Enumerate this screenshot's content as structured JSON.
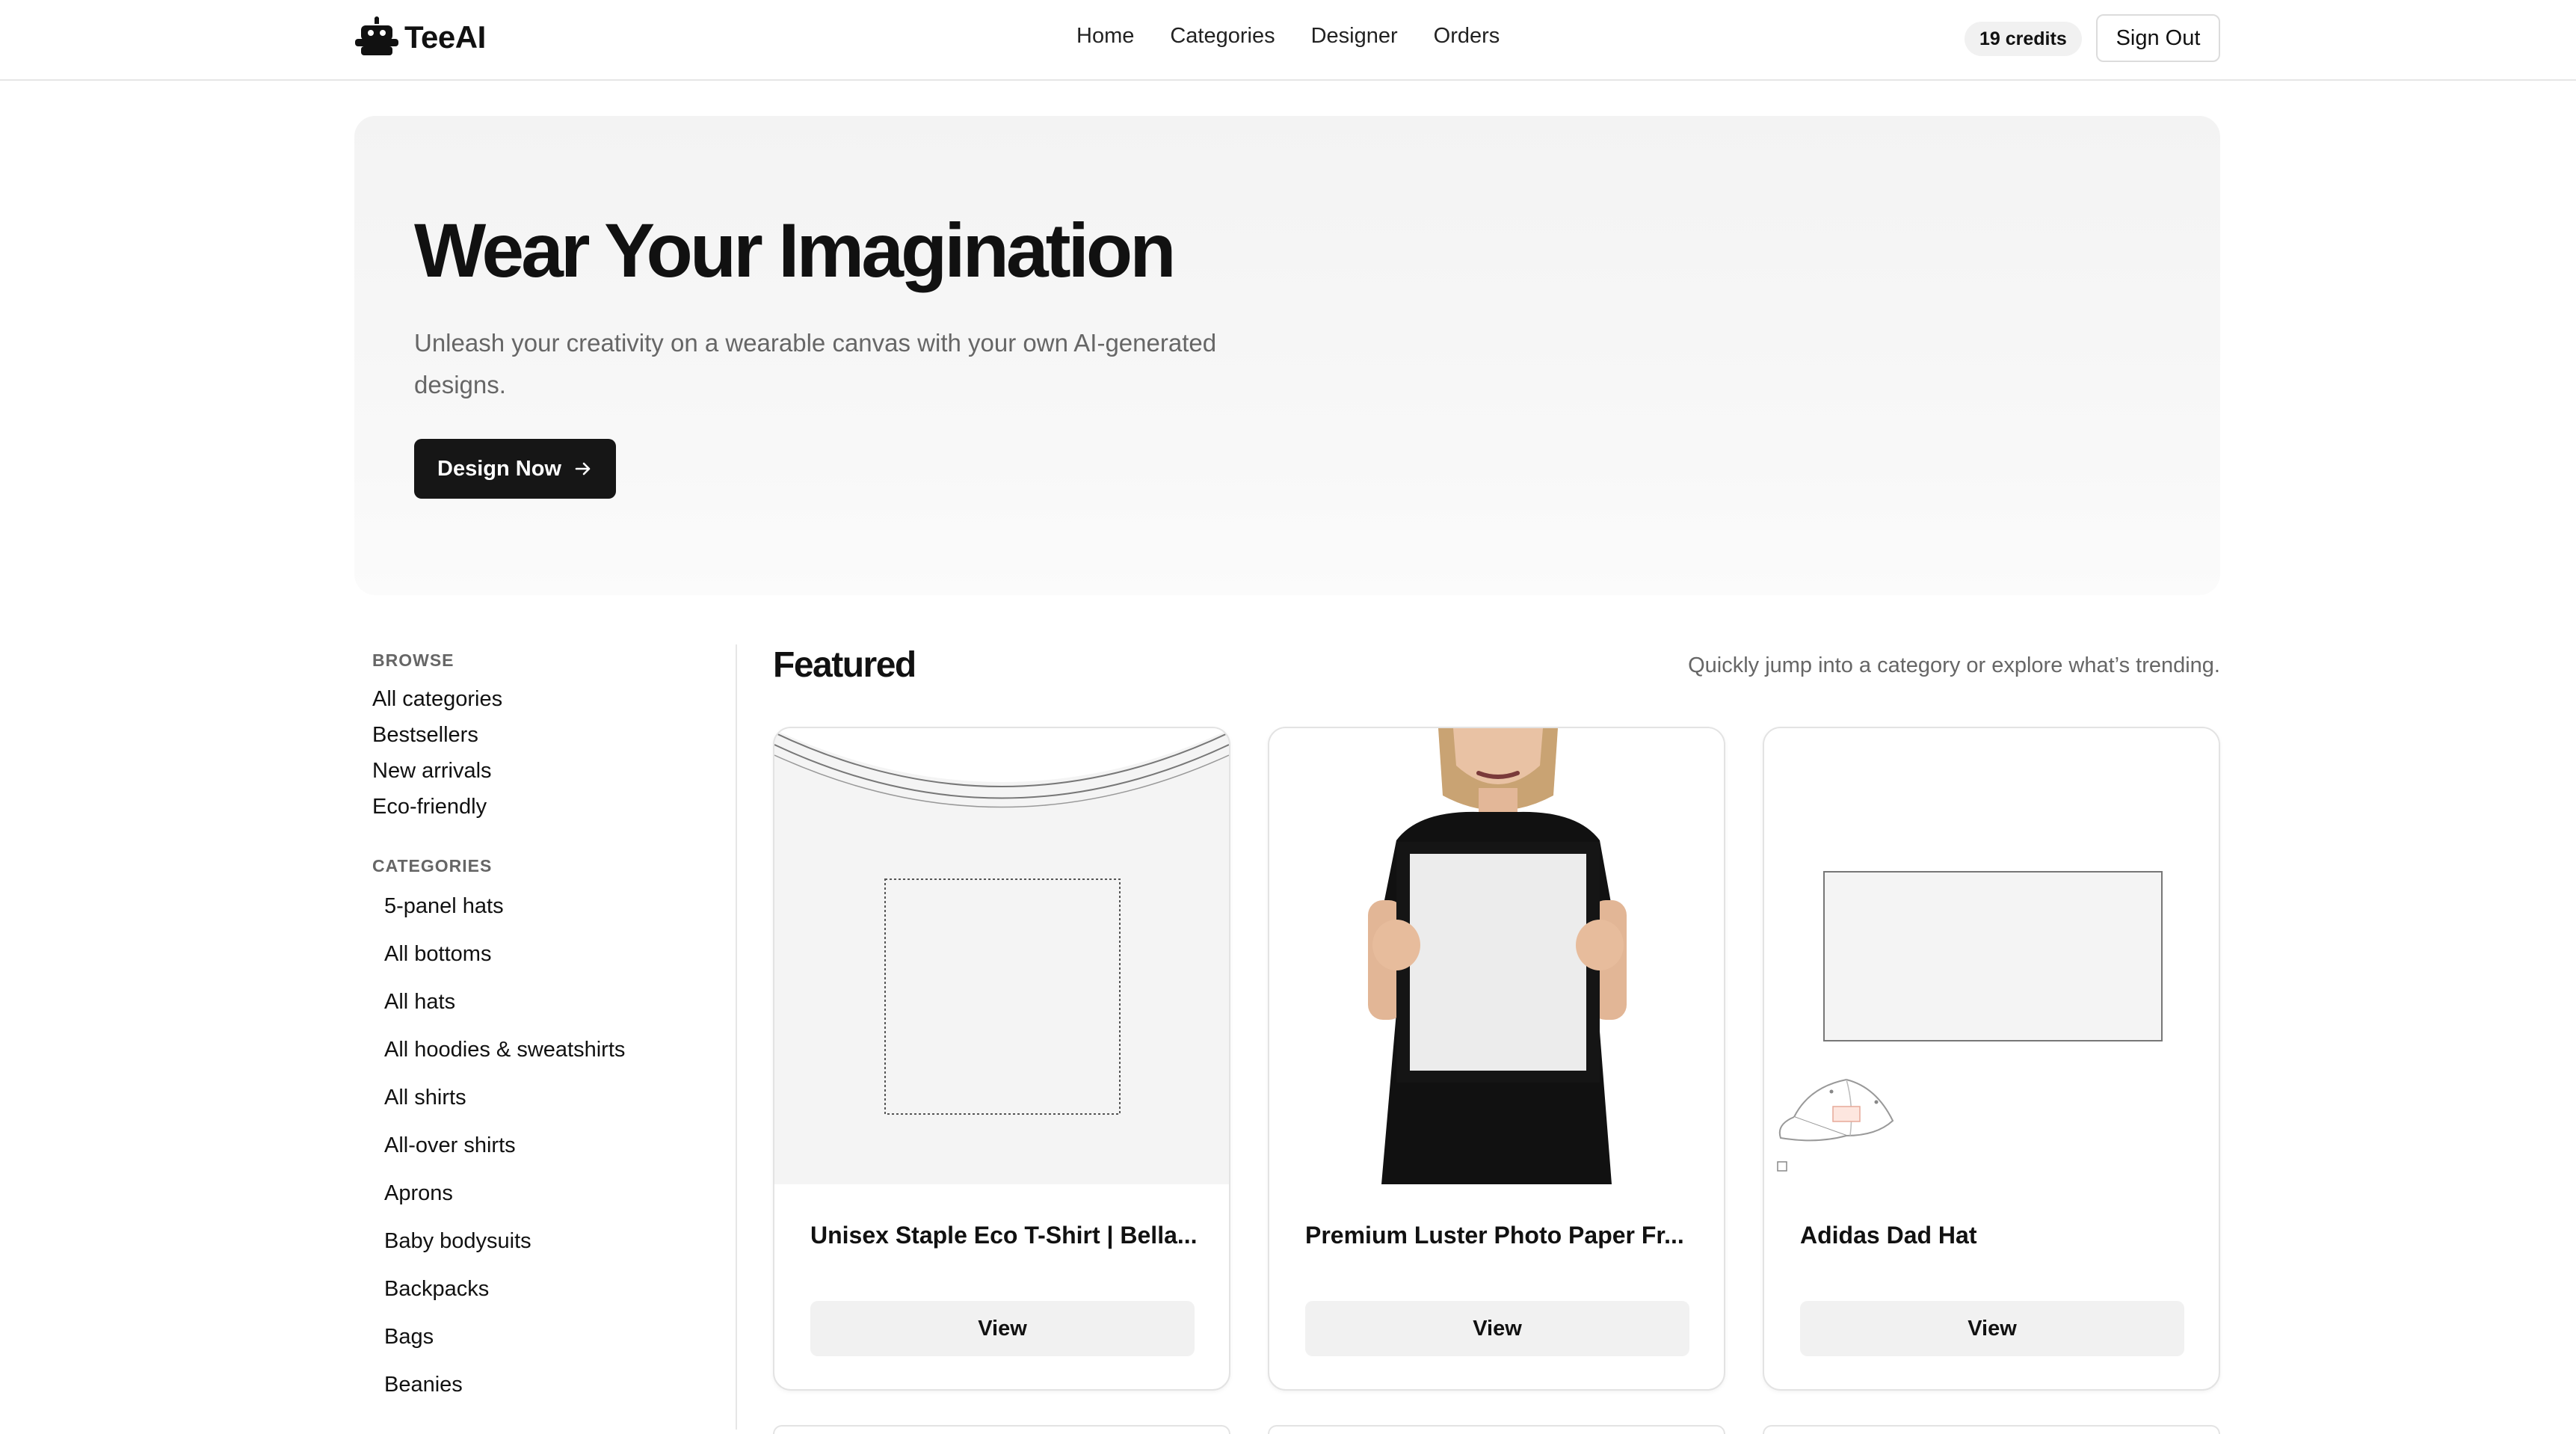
{
  "header": {
    "brand": "TeeAI",
    "nav": [
      "Home",
      "Categories",
      "Designer",
      "Orders"
    ],
    "credits": "19 credits",
    "sign_out": "Sign Out"
  },
  "hero": {
    "title": "Wear Your Imagination",
    "subtitle": "Unleash your creativity on a wearable canvas with your own AI-generated designs.",
    "cta": "Design Now"
  },
  "sidebar": {
    "browse_heading": "BROWSE",
    "browse": [
      "All categories",
      "Bestsellers",
      "New arrivals",
      "Eco-friendly"
    ],
    "categories_heading": "CATEGORIES",
    "categories": [
      "5-panel hats",
      "All bottoms",
      "All hats",
      "All hoodies & sweatshirts",
      "All shirts",
      "All-over shirts",
      "Aprons",
      "Baby bodysuits",
      "Backpacks",
      "Bags",
      "Beanies"
    ]
  },
  "featured": {
    "title": "Featured",
    "subtitle": "Quickly jump into a category or explore what’s trending.",
    "products": [
      {
        "name": "Unisex Staple Eco T-Shirt | Bella...",
        "button": "View",
        "icon": "tshirt-mockup"
      },
      {
        "name": "Premium Luster Photo Paper Fr...",
        "button": "View",
        "icon": "framed-poster-mockup"
      },
      {
        "name": "Adidas Dad Hat",
        "button": "View",
        "icon": "hat-mockup"
      }
    ]
  },
  "colors": {
    "accent": "#161616",
    "hero_bg": "#f3f3f3",
    "muted": "#666666"
  }
}
